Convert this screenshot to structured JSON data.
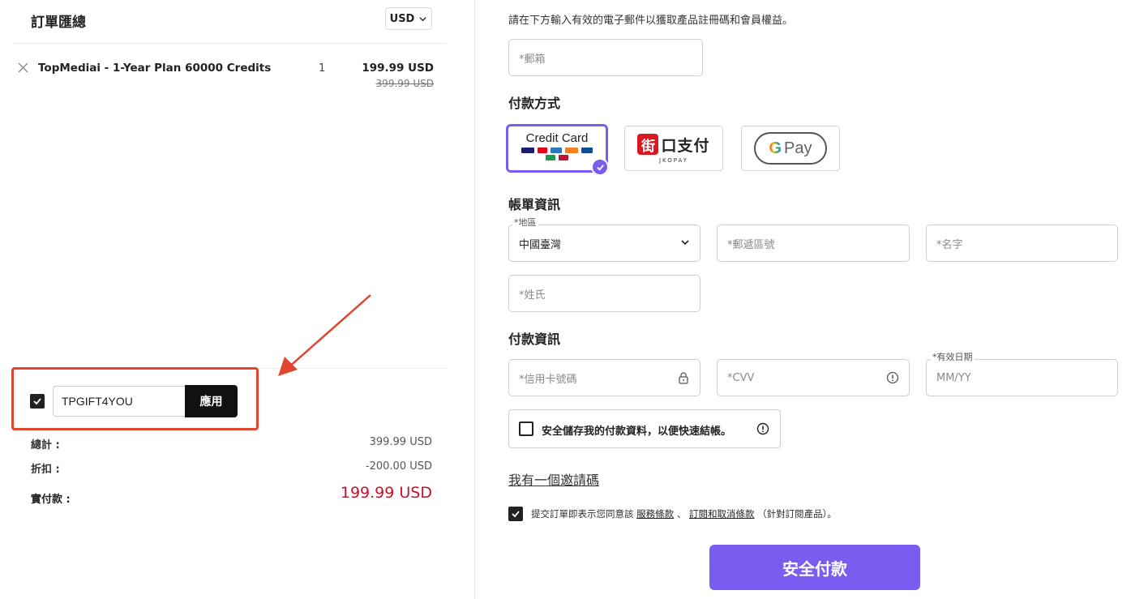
{
  "order": {
    "title": "訂單匯總",
    "currency": "USD",
    "item": {
      "name": "TopMediai - 1-Year Plan 60000 Credits",
      "quantity": "1",
      "price": "199.99 USD",
      "original_price": "399.99 USD"
    },
    "coupon": {
      "code": "TPGIFT4YOU",
      "apply_label": "應用",
      "checked": true
    },
    "summary": {
      "total_label": "總計 :",
      "total_value": "399.99 USD",
      "discount_label": "折扣 :",
      "discount_value": "-200.00 USD",
      "pay_label": "實付款 :",
      "pay_value": "199.99 USD"
    }
  },
  "checkout": {
    "email_hint": "請在下方輸入有效的電子郵件以獲取產品註冊碼和會員權益。",
    "email_placeholder": "*郵箱",
    "payment_method_title": "付款方式",
    "payment_methods": {
      "card_label": "Credit Card",
      "jko_label": "口支付",
      "jko_logo_char": "街",
      "jko_sub": "JKOPAY",
      "gpay_g": "G",
      "gpay_label": "Pay"
    },
    "billing_title": "帳單資訊",
    "region_label": "*地區",
    "region_value": "中國臺灣",
    "zip_placeholder": "*郵遞區號",
    "first_name_placeholder": "*名字",
    "last_name_placeholder": "*姓氏",
    "payment_info_title": "付款資訊",
    "card_number_placeholder": "*信用卡號碼",
    "cvv_placeholder": "*CVV",
    "expiry_label": "*有效日期",
    "expiry_placeholder": "MM/YY",
    "save_payment_text": "安全儲存我的付款資料，以便快速結帳。",
    "invite_link": "我有一個邀請碼",
    "terms": {
      "prefix": "提交訂單即表示您同意該",
      "terms_link": "服務條款",
      "sep": "、",
      "sub_link": "訂閱和取消條款",
      "suffix": "（針對訂閱產品）。"
    },
    "pay_button": "安全付款"
  },
  "colors": {
    "accent": "#7b5cf0",
    "price_red": "#c8102e",
    "highlight_red": "#e0452f"
  }
}
